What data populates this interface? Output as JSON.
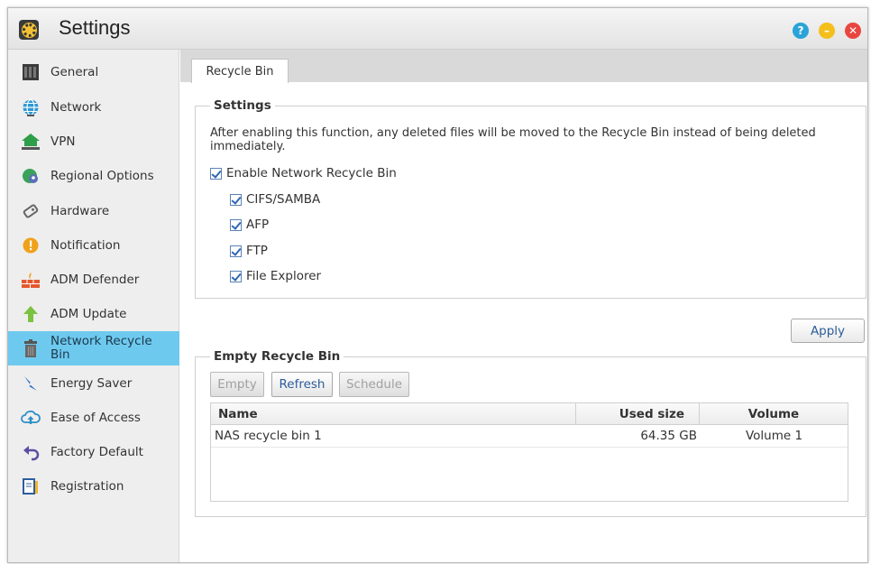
{
  "window": {
    "title": "Settings",
    "help_glyph": "?",
    "minimize_glyph": "–",
    "close_glyph": "✕"
  },
  "sidebar": {
    "items": [
      {
        "label": "General",
        "icon": "general-icon"
      },
      {
        "label": "Network",
        "icon": "globe-icon"
      },
      {
        "label": "VPN",
        "icon": "vpn-icon"
      },
      {
        "label": "Regional Options",
        "icon": "regional-icon"
      },
      {
        "label": "Hardware",
        "icon": "hardware-icon"
      },
      {
        "label": "Notification",
        "icon": "notification-icon"
      },
      {
        "label": "ADM Defender",
        "icon": "firewall-icon"
      },
      {
        "label": "ADM Update",
        "icon": "update-arrow-icon"
      },
      {
        "label": "Network Recycle Bin",
        "icon": "trash-icon",
        "active": true
      },
      {
        "label": "Energy Saver",
        "icon": "lightning-icon"
      },
      {
        "label": "Ease of Access",
        "icon": "cloud-upload-icon"
      },
      {
        "label": "Factory Default",
        "icon": "reset-arrow-icon"
      },
      {
        "label": "Registration",
        "icon": "clipboard-icon"
      }
    ]
  },
  "tab": {
    "label": "Recycle Bin"
  },
  "settings": {
    "legend": "Settings",
    "description": "After enabling this function, any deleted files will be moved to the Recycle Bin instead of being deleted immediately.",
    "enable_label": "Enable Network Recycle Bin",
    "enable_checked": true,
    "protocols": [
      {
        "label": "CIFS/SAMBA",
        "checked": true
      },
      {
        "label": "AFP",
        "checked": true
      },
      {
        "label": "FTP",
        "checked": true
      },
      {
        "label": "File Explorer",
        "checked": true
      }
    ]
  },
  "apply_label": "Apply",
  "empty_bin": {
    "legend": "Empty Recycle Bin",
    "buttons": {
      "empty": "Empty",
      "refresh": "Refresh",
      "schedule": "Schedule"
    },
    "columns": {
      "name": "Name",
      "used_size": "Used size",
      "volume": "Volume"
    },
    "rows": [
      {
        "name": "NAS recycle bin 1",
        "used_size": "64.35 GB",
        "volume": "Volume 1"
      }
    ]
  },
  "colors": {
    "accent": "#6ec9ef",
    "link_blue": "#2b5c9a"
  }
}
